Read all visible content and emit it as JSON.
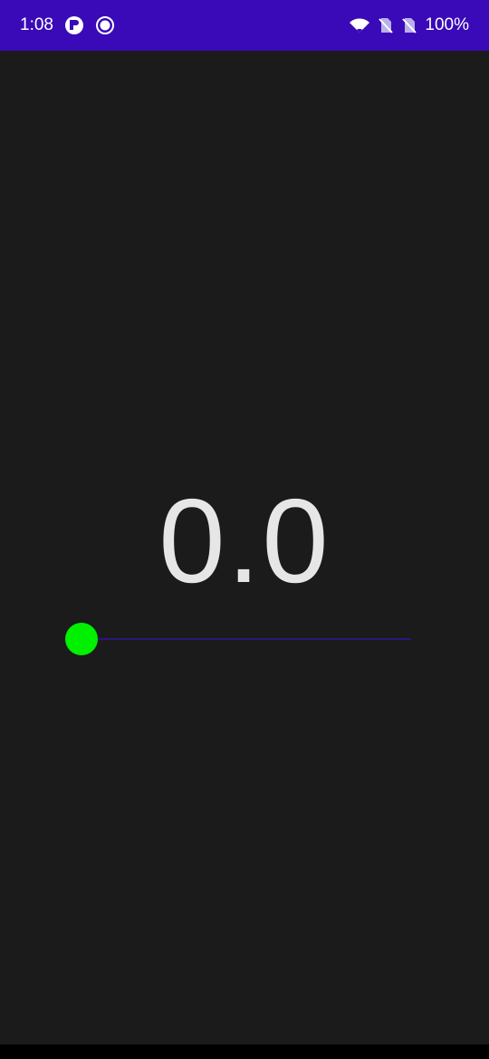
{
  "status_bar": {
    "time": "1:08",
    "battery": "100%",
    "icons": [
      "pocket-app-icon",
      "record-icon",
      "wifi-icon",
      "no-sim-icon",
      "no-sim-icon",
      "battery-text"
    ]
  },
  "main": {
    "value": "0.0"
  },
  "slider": {
    "level": 0,
    "thumb_color": "#00f000",
    "track_color": "#2a167a"
  },
  "colors": {
    "status_bar": "#3a0ab8",
    "background": "#1b1b1b",
    "value_text": "#e6e6e6"
  }
}
